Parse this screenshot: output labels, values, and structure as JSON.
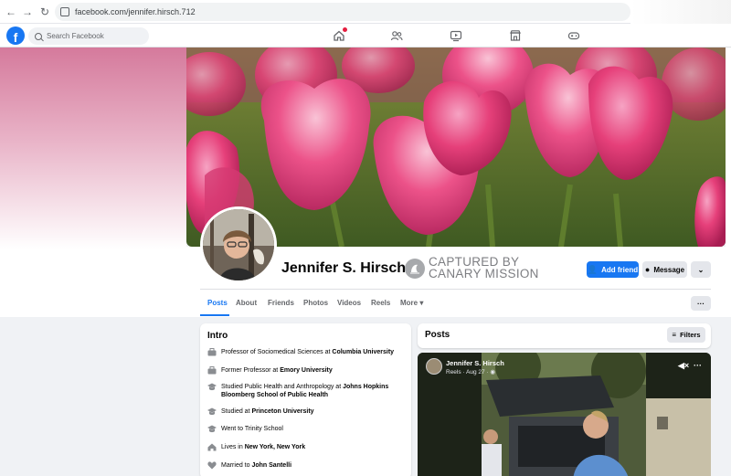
{
  "browser": {
    "back_icon": "←",
    "forward_icon": "→",
    "reload_icon": "↻",
    "url": "facebook.com/jennifer.hirsch.712"
  },
  "fbnav": {
    "logo": "f",
    "search_placeholder": "Search Facebook",
    "icons": [
      "home-icon",
      "friends-icon",
      "video-icon",
      "marketplace-icon",
      "gaming-icon"
    ]
  },
  "profile": {
    "name": "Jennifer S. Hirsch",
    "overlay_line1": "CAPTURED BY",
    "overlay_line2": "CANARY MISSION",
    "add_friend": "Add friend",
    "message": "Message",
    "more_chevron": "⌄",
    "more_dots": "···"
  },
  "tabs": [
    "Posts",
    "About",
    "Friends",
    "Photos",
    "Videos",
    "Reels",
    "More ▾"
  ],
  "intro": {
    "title": "Intro",
    "items": [
      {
        "icon": "briefcase-icon",
        "prefix": "Professor of Sociomedical Sciences at ",
        "bold": "Columbia University",
        "suffix": ""
      },
      {
        "icon": "briefcase-icon",
        "prefix": "Former Professor at ",
        "bold": "Emory University",
        "suffix": ""
      },
      {
        "icon": "graduation-cap-icon",
        "prefix": "Studied Public Health and Anthropology at ",
        "bold": "Johns Hopkins Bloomberg School of Public Health",
        "suffix": ""
      },
      {
        "icon": "graduation-cap-icon",
        "prefix": "Studied at ",
        "bold": "Princeton University",
        "suffix": ""
      },
      {
        "icon": "graduation-cap-icon",
        "prefix": "Went to Trinity School",
        "bold": "",
        "suffix": ""
      },
      {
        "icon": "home-icon",
        "prefix": "Lives in ",
        "bold": "New York, New York",
        "suffix": ""
      },
      {
        "icon": "heart-icon",
        "prefix": "Married to ",
        "bold": "John Santelli",
        "suffix": ""
      }
    ]
  },
  "posts": {
    "title": "Posts",
    "filters": "Filters",
    "reel_author": "Jennifer S. Hirsch",
    "reel_meta": "Reels · Aug 27 · ",
    "mute_icon": "◀×",
    "dots": "···"
  },
  "colors": {
    "fb_blue": "#1877f2",
    "tulip_pink": "#e8326e",
    "background": "#f0f2f5"
  }
}
